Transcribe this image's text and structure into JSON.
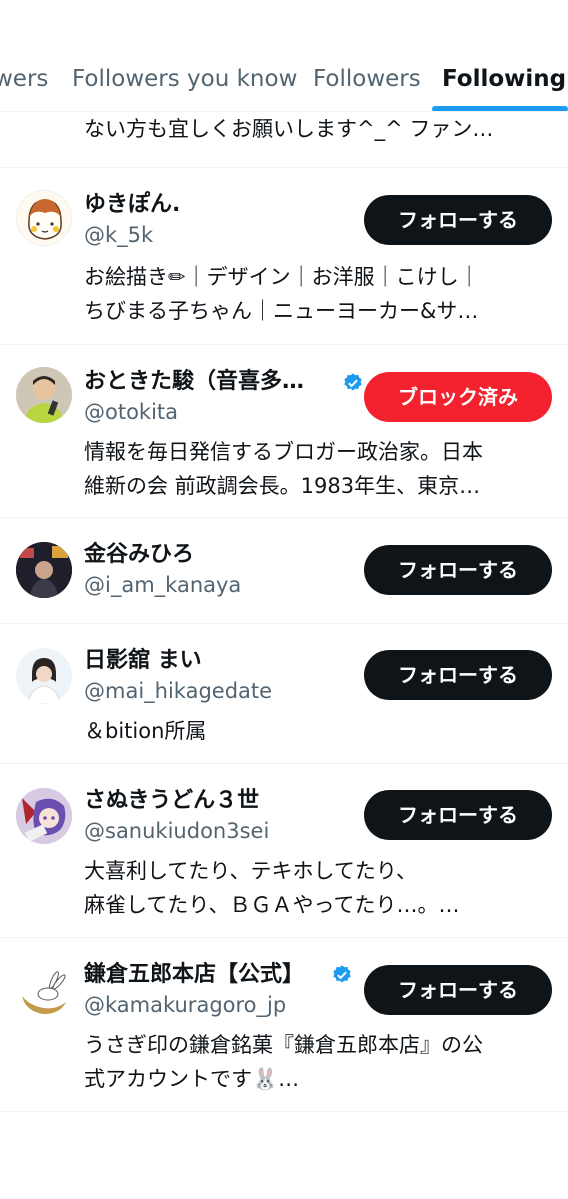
{
  "tabs": {
    "partial": "wers",
    "followers_you_know": "Followers you know",
    "followers": "Followers",
    "following": "Following"
  },
  "top_partial": {
    "bio_line1": "ない方も宜しくお願いします^_^ ファン…"
  },
  "users": [
    {
      "name": "ゆきぽん.",
      "handle": "@k_5k",
      "button": "フォローする",
      "bio1": "お絵描き✏︎｜デザイン｜お洋服｜こけし｜",
      "bio2": "ちびまる子ちゃん｜ニューヨーカー&サ…"
    },
    {
      "name": "おときた駿（音喜多…",
      "handle": "@otokita",
      "button": "ブロック済み",
      "bio1": "情報を毎日発信するブロガー政治家。日本",
      "bio2": "維新の会 前政調会長。1983年生、東京…"
    },
    {
      "name": "金谷みひろ",
      "handle": "@i_am_kanaya",
      "button": "フォローする"
    },
    {
      "name": "日影舘 まい",
      "handle": "@mai_hikagedate",
      "button": "フォローする",
      "bio1": "＆bition所属"
    },
    {
      "name": "さぬきうどん３世",
      "handle": "@sanukiudon3sei",
      "button": "フォローする",
      "bio1": "大喜利してたり、テキホしてたり、",
      "bio2": "麻雀してたり、ＢＧＡやってたり…。…"
    },
    {
      "name": "鎌倉五郎本店【公式】",
      "handle": "@kamakuragoro_jp",
      "button": "フォローする",
      "bio1": "うさぎ印の鎌倉銘菓『鎌倉五郎本店』の公",
      "bio2": "式アカウントです🐰…"
    }
  ],
  "colors": {
    "accent": "#1d9bf0",
    "blocked": "#f4212e",
    "follow": "#0f1419",
    "secondary_text": "#536471"
  }
}
